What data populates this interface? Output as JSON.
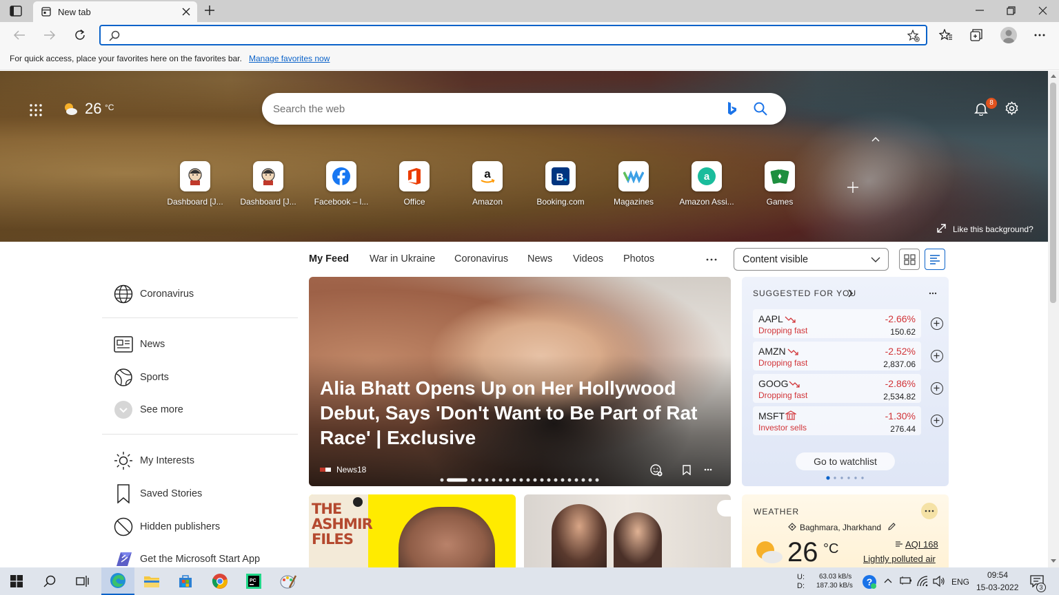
{
  "browser": {
    "tab_title": "New tab",
    "address_value": "",
    "favbar_message": "For quick access, place your favorites here on the favorites bar.",
    "favbar_link": "Manage favorites now"
  },
  "hero": {
    "temperature": "26",
    "temp_unit": "°C",
    "search_placeholder": "Search the web",
    "notification_count": "8",
    "like_background": "Like this background?",
    "quick_links": [
      {
        "label": "Dashboard [J...",
        "icon": "jenkins-icon"
      },
      {
        "label": "Dashboard [J...",
        "icon": "jenkins-icon"
      },
      {
        "label": "Facebook – l...",
        "icon": "facebook-icon"
      },
      {
        "label": "Office",
        "icon": "office-icon"
      },
      {
        "label": "Amazon",
        "icon": "amazon-icon"
      },
      {
        "label": "Booking.com",
        "icon": "booking-icon"
      },
      {
        "label": "Magazines",
        "icon": "magazines-icon"
      },
      {
        "label": "Amazon Assi...",
        "icon": "amazon-assistant-icon"
      },
      {
        "label": "Games",
        "icon": "games-icon"
      }
    ]
  },
  "feed": {
    "tabs": [
      "My Feed",
      "War in Ukraine",
      "Coronavirus",
      "News",
      "Videos",
      "Photos"
    ],
    "content_select": "Content visible"
  },
  "left_nav": {
    "items": [
      "Coronavirus",
      "News",
      "Sports",
      "See more",
      "My Interests",
      "Saved Stories",
      "Hidden publishers",
      "Get the Microsoft Start App"
    ]
  },
  "hero_card": {
    "headline": "Alia Bhatt Opens Up on Her Hollywood Debut, Says 'Don't Want to Be Part of Rat Race' | Exclusive",
    "source": "News18"
  },
  "stocks": {
    "header": "SUGGESTED FOR YOU",
    "items": [
      {
        "symbol": "AAPL",
        "trend": "Dropping fast",
        "change": "-2.66%",
        "price": "150.62"
      },
      {
        "symbol": "AMZN",
        "trend": "Dropping fast",
        "change": "-2.52%",
        "price": "2,837.06"
      },
      {
        "symbol": "GOOG",
        "trend": "Dropping fast",
        "change": "-2.86%",
        "price": "2,534.82"
      },
      {
        "symbol": "MSFT",
        "trend": "Investor sells",
        "change": "-1.30%",
        "price": "276.44"
      }
    ],
    "watchlist_button": "Go to watchlist"
  },
  "card2": {
    "title_text": "THE ASHMIR FILES"
  },
  "weather": {
    "header": "WEATHER",
    "location": "Baghmara, Jharkhand",
    "temperature": "26",
    "unit": "°C",
    "aqi": "AQI 168",
    "aqi_desc": "Lightly polluted air"
  },
  "taskbar": {
    "upload": "63.03 kB/s",
    "download": "187.30 kB/s",
    "up_label": "U:",
    "down_label": "D:",
    "language": "ENG",
    "time": "09:54",
    "date": "15-03-2022",
    "notification_count": "3"
  },
  "colors": {
    "accent": "#0a62c9",
    "negative": "#d13438",
    "taskbar": "#dfe4ec"
  }
}
